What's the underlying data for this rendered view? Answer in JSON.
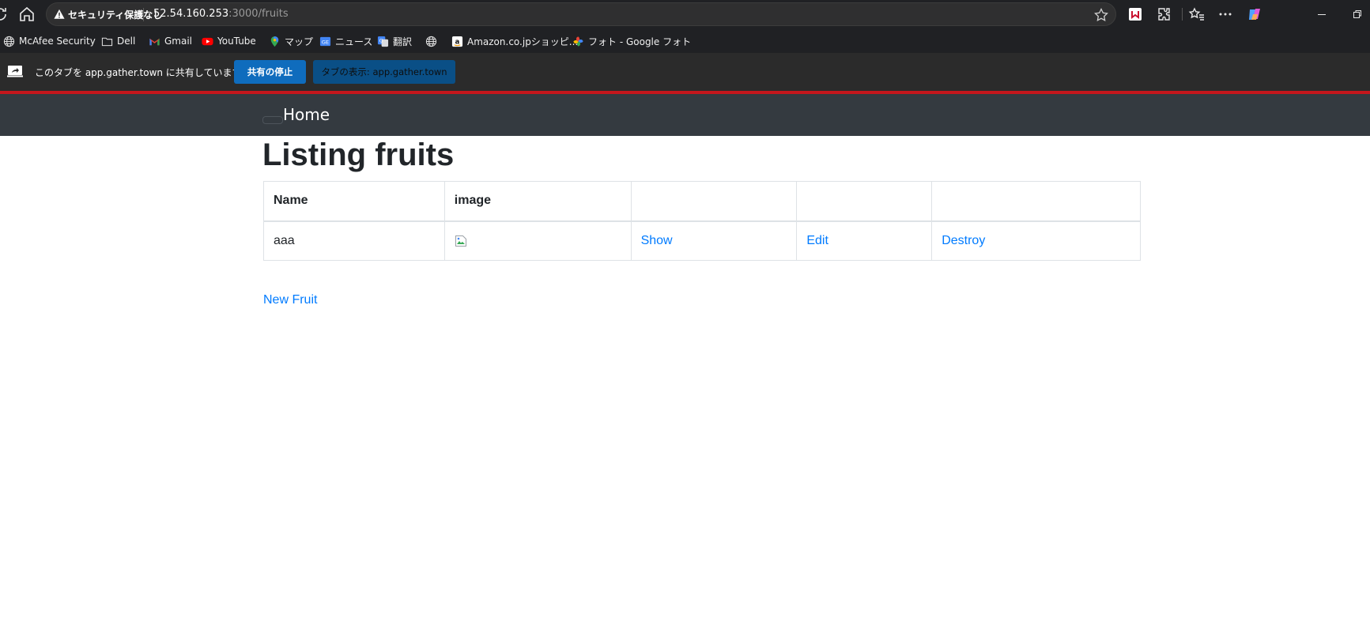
{
  "browser": {
    "security_label": "セキュリティ保護なし",
    "url_host": "52.54.160.253",
    "url_path": ":3000/fruits"
  },
  "bookmarks": [
    {
      "label": "McAfee Security",
      "icon": "globe-icon"
    },
    {
      "label": "Dell",
      "icon": "folder-icon"
    },
    {
      "label": "Gmail",
      "icon": "gmail-icon"
    },
    {
      "label": "YouTube",
      "icon": "youtube-icon"
    },
    {
      "label": "マップ",
      "icon": "maps-icon"
    },
    {
      "label": "ニュース",
      "icon": "news-icon"
    },
    {
      "label": "翻訳",
      "icon": "translate-icon"
    },
    {
      "label": "",
      "icon": "globe-icon"
    },
    {
      "label": "Amazon.co.jpショッピ...",
      "icon": "amazon-icon"
    },
    {
      "label": "フォト - Google フォト",
      "icon": "photos-icon"
    }
  ],
  "share_bar": {
    "message": "このタブを app.gather.town に共有しています",
    "stop_label": "共有の停止",
    "view_label": "タブの表示: app.gather.town"
  },
  "app": {
    "brand": "Home",
    "title": "Listing fruits",
    "table": {
      "headers": [
        "Name",
        "image",
        "",
        "",
        ""
      ],
      "rows": [
        {
          "name": "aaa",
          "show": "Show",
          "edit": "Edit",
          "destroy": "Destroy"
        }
      ]
    },
    "new_link": "New Fruit"
  },
  "colors": {
    "link": "#007bff",
    "navbar": "#343a40",
    "share_stop": "#0f6cbd",
    "accent_line": "#c4161c"
  }
}
